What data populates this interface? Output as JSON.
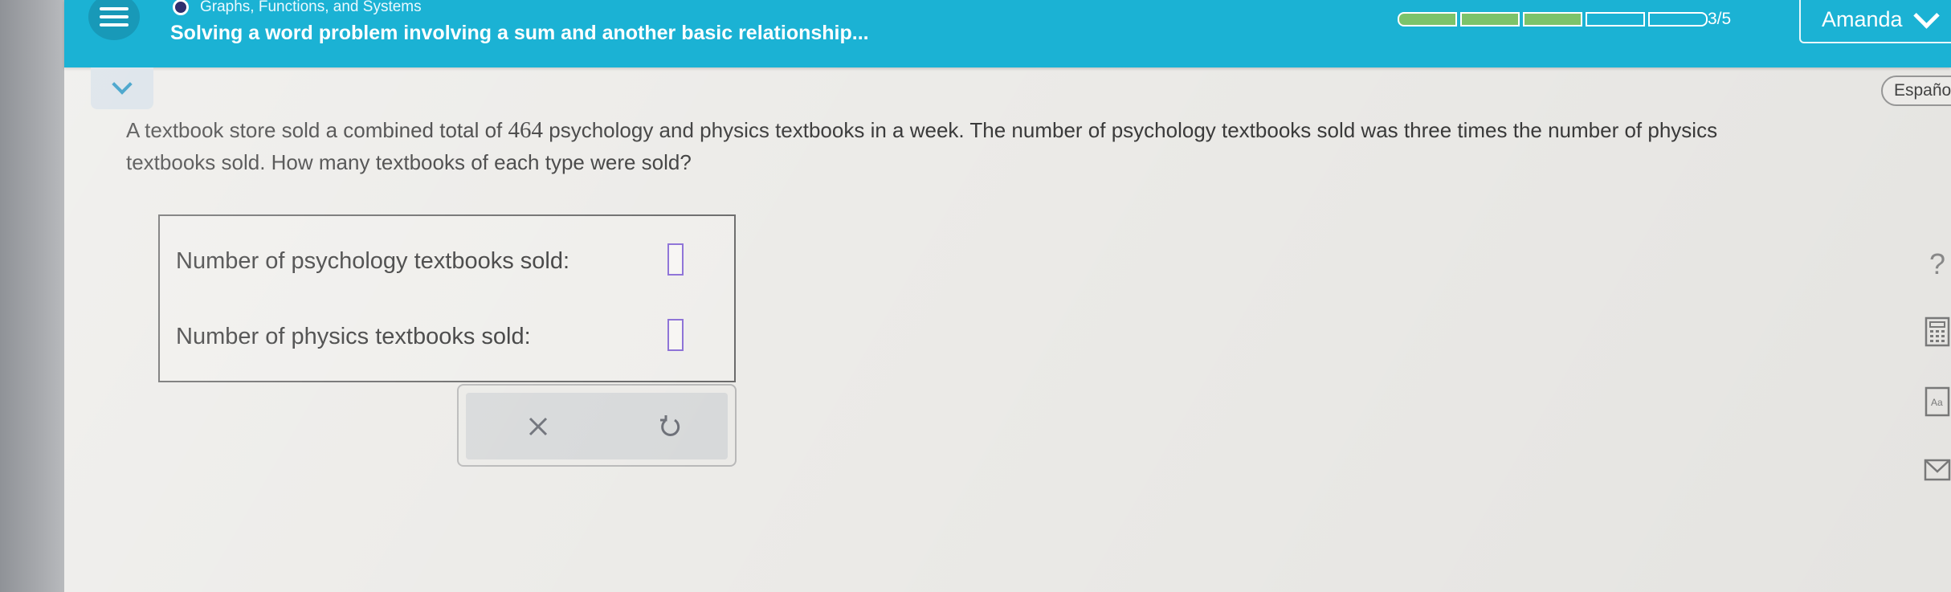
{
  "header": {
    "topic": "Graphs, Functions, and Systems",
    "lesson_title": "Solving a word problem involving a sum and another basic relationship...",
    "progress": {
      "current": 3,
      "total": 5,
      "label": "3/5"
    },
    "user_name": "Amanda"
  },
  "language_button": "Españo",
  "problem": {
    "text_before": "A textbook store sold a combined total of ",
    "total": "464",
    "text_after": " psychology and physics textbooks in a week. The number of psychology textbooks sold was three times the number of physics textbooks sold. How many textbooks of each type were sold?"
  },
  "answers": {
    "psychology_label": "Number of psychology textbooks sold:",
    "physics_label": "Number of physics textbooks sold:",
    "psychology_value": "",
    "physics_value": ""
  },
  "colors": {
    "header": "#1bb2d4",
    "progress_filled": "#7cc36a",
    "input_border": "#8b6fd6"
  },
  "icons": {
    "menu": "hamburger-menu-icon",
    "clear": "x-icon",
    "undo": "undo-icon",
    "help": "question-mark-icon",
    "calculator": "calculator-icon",
    "dictionary": "aa-dictionary-icon",
    "mail": "mail-icon"
  }
}
